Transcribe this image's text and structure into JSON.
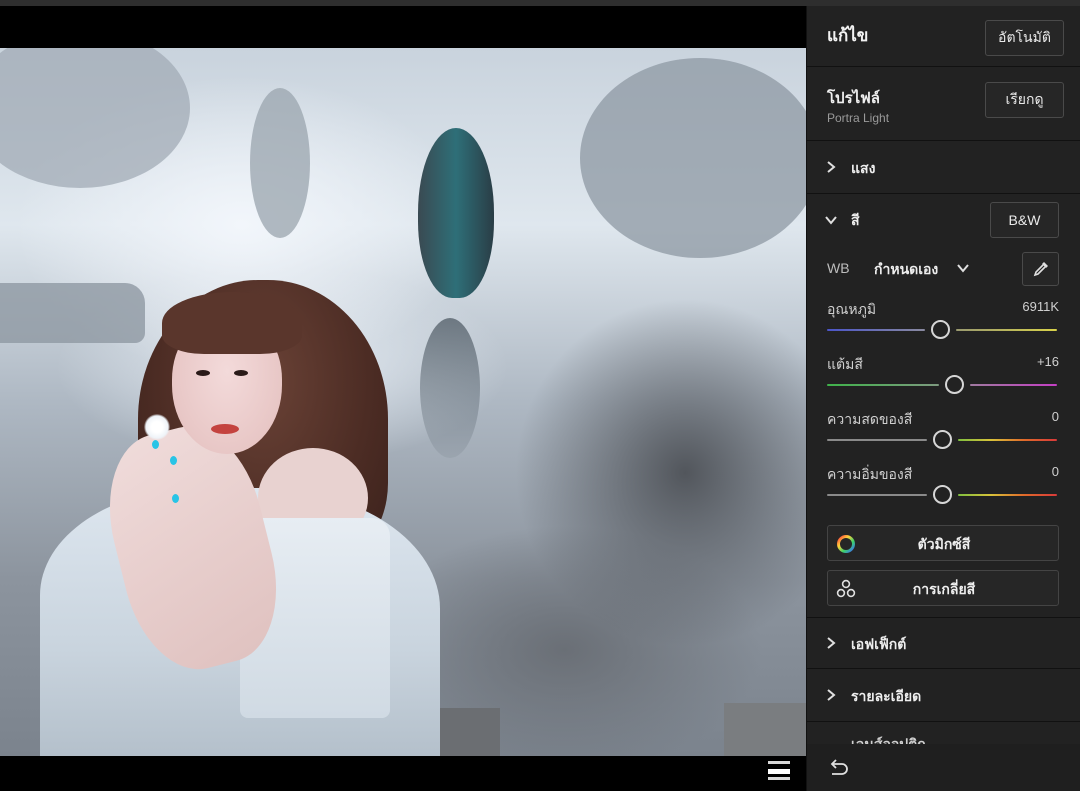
{
  "panel": {
    "title": "แก้ไข",
    "auto_label": "อัตโนมัติ",
    "profile": {
      "label": "โปรไฟล์",
      "value": "Portra Light",
      "browse_label": "เรียกดู"
    },
    "sections": {
      "light": "แสง",
      "color": "สี",
      "effects": "เอฟเฟ็กต์",
      "detail": "รายละเอียด",
      "optics": "เลนส์ออปติก"
    },
    "bw_label": "B&W",
    "wb": {
      "label": "WB",
      "value": "กำหนดเอง"
    },
    "sliders": {
      "temp": {
        "label": "อุณหภูมิ",
        "value": "6911K",
        "position": 0.49
      },
      "tint": {
        "label": "แต้มสี",
        "value": "+16",
        "position": 0.55
      },
      "vibrance": {
        "label": "ความสดของสี",
        "value": "0",
        "position": 0.5
      },
      "saturation": {
        "label": "ความอิ่มของสี",
        "value": "0",
        "position": 0.5
      }
    },
    "color_mixer_label": "ตัวมิกซ์สี",
    "color_grading_label": "การเกลี่ยสี"
  },
  "icons": {
    "expand": "chevron-right-icon",
    "collapse": "chevron-down-icon",
    "eyedropper": "eyedropper-icon",
    "undo": "undo-icon",
    "filmstrip": "filmstrip-icon",
    "color_mixer": "color-wheel-icon",
    "color_grading": "color-grading-icon"
  },
  "colors": {
    "panel_bg": "#222222",
    "temp_track": [
      "#4b55c8",
      "#d8d24a"
    ],
    "tint_track": [
      "#3fb24a",
      "#c43fc4"
    ]
  }
}
